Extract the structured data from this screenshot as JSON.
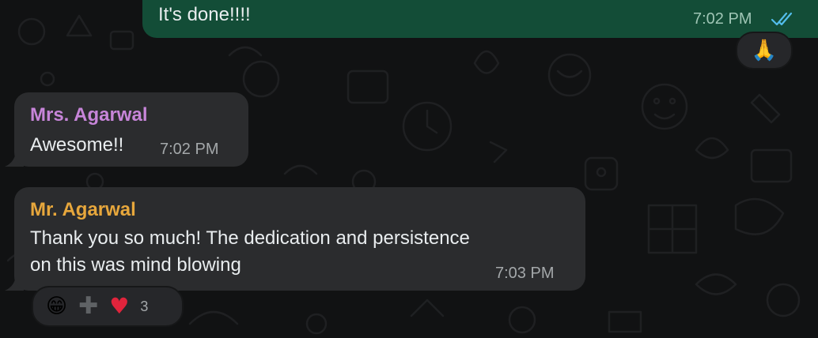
{
  "messages": [
    {
      "direction": "outgoing",
      "text": "It's done!!!!",
      "time": "7:02 PM",
      "status_icon": "double-check-read-icon",
      "reaction": {
        "emoji": "🙏",
        "icon": "folded-hands-icon"
      }
    },
    {
      "direction": "incoming",
      "sender": "Mrs. Agarwal",
      "sender_color": "#c785d9",
      "text": "Awesome!!",
      "time": "7:02 PM"
    },
    {
      "direction": "incoming",
      "sender": "Mr. Agarwal",
      "sender_color": "#e7a73c",
      "text_lines": [
        "Thank you so much! The dedication and persistence",
        "on this was mind blowing"
      ],
      "time": "7:03 PM",
      "reactions": {
        "items": [
          {
            "emoji": "😁",
            "icon": "grinning-face-icon"
          },
          {
            "emoji": "➕",
            "icon": "plus-icon"
          },
          {
            "emoji": "❤️",
            "icon": "red-heart-icon"
          }
        ],
        "count": "3"
      }
    }
  ],
  "colors": {
    "background": "#111213",
    "outgoing_bubble": "#134d37",
    "incoming_bubble": "#2b2c2e",
    "read_check": "#53bdeb"
  }
}
